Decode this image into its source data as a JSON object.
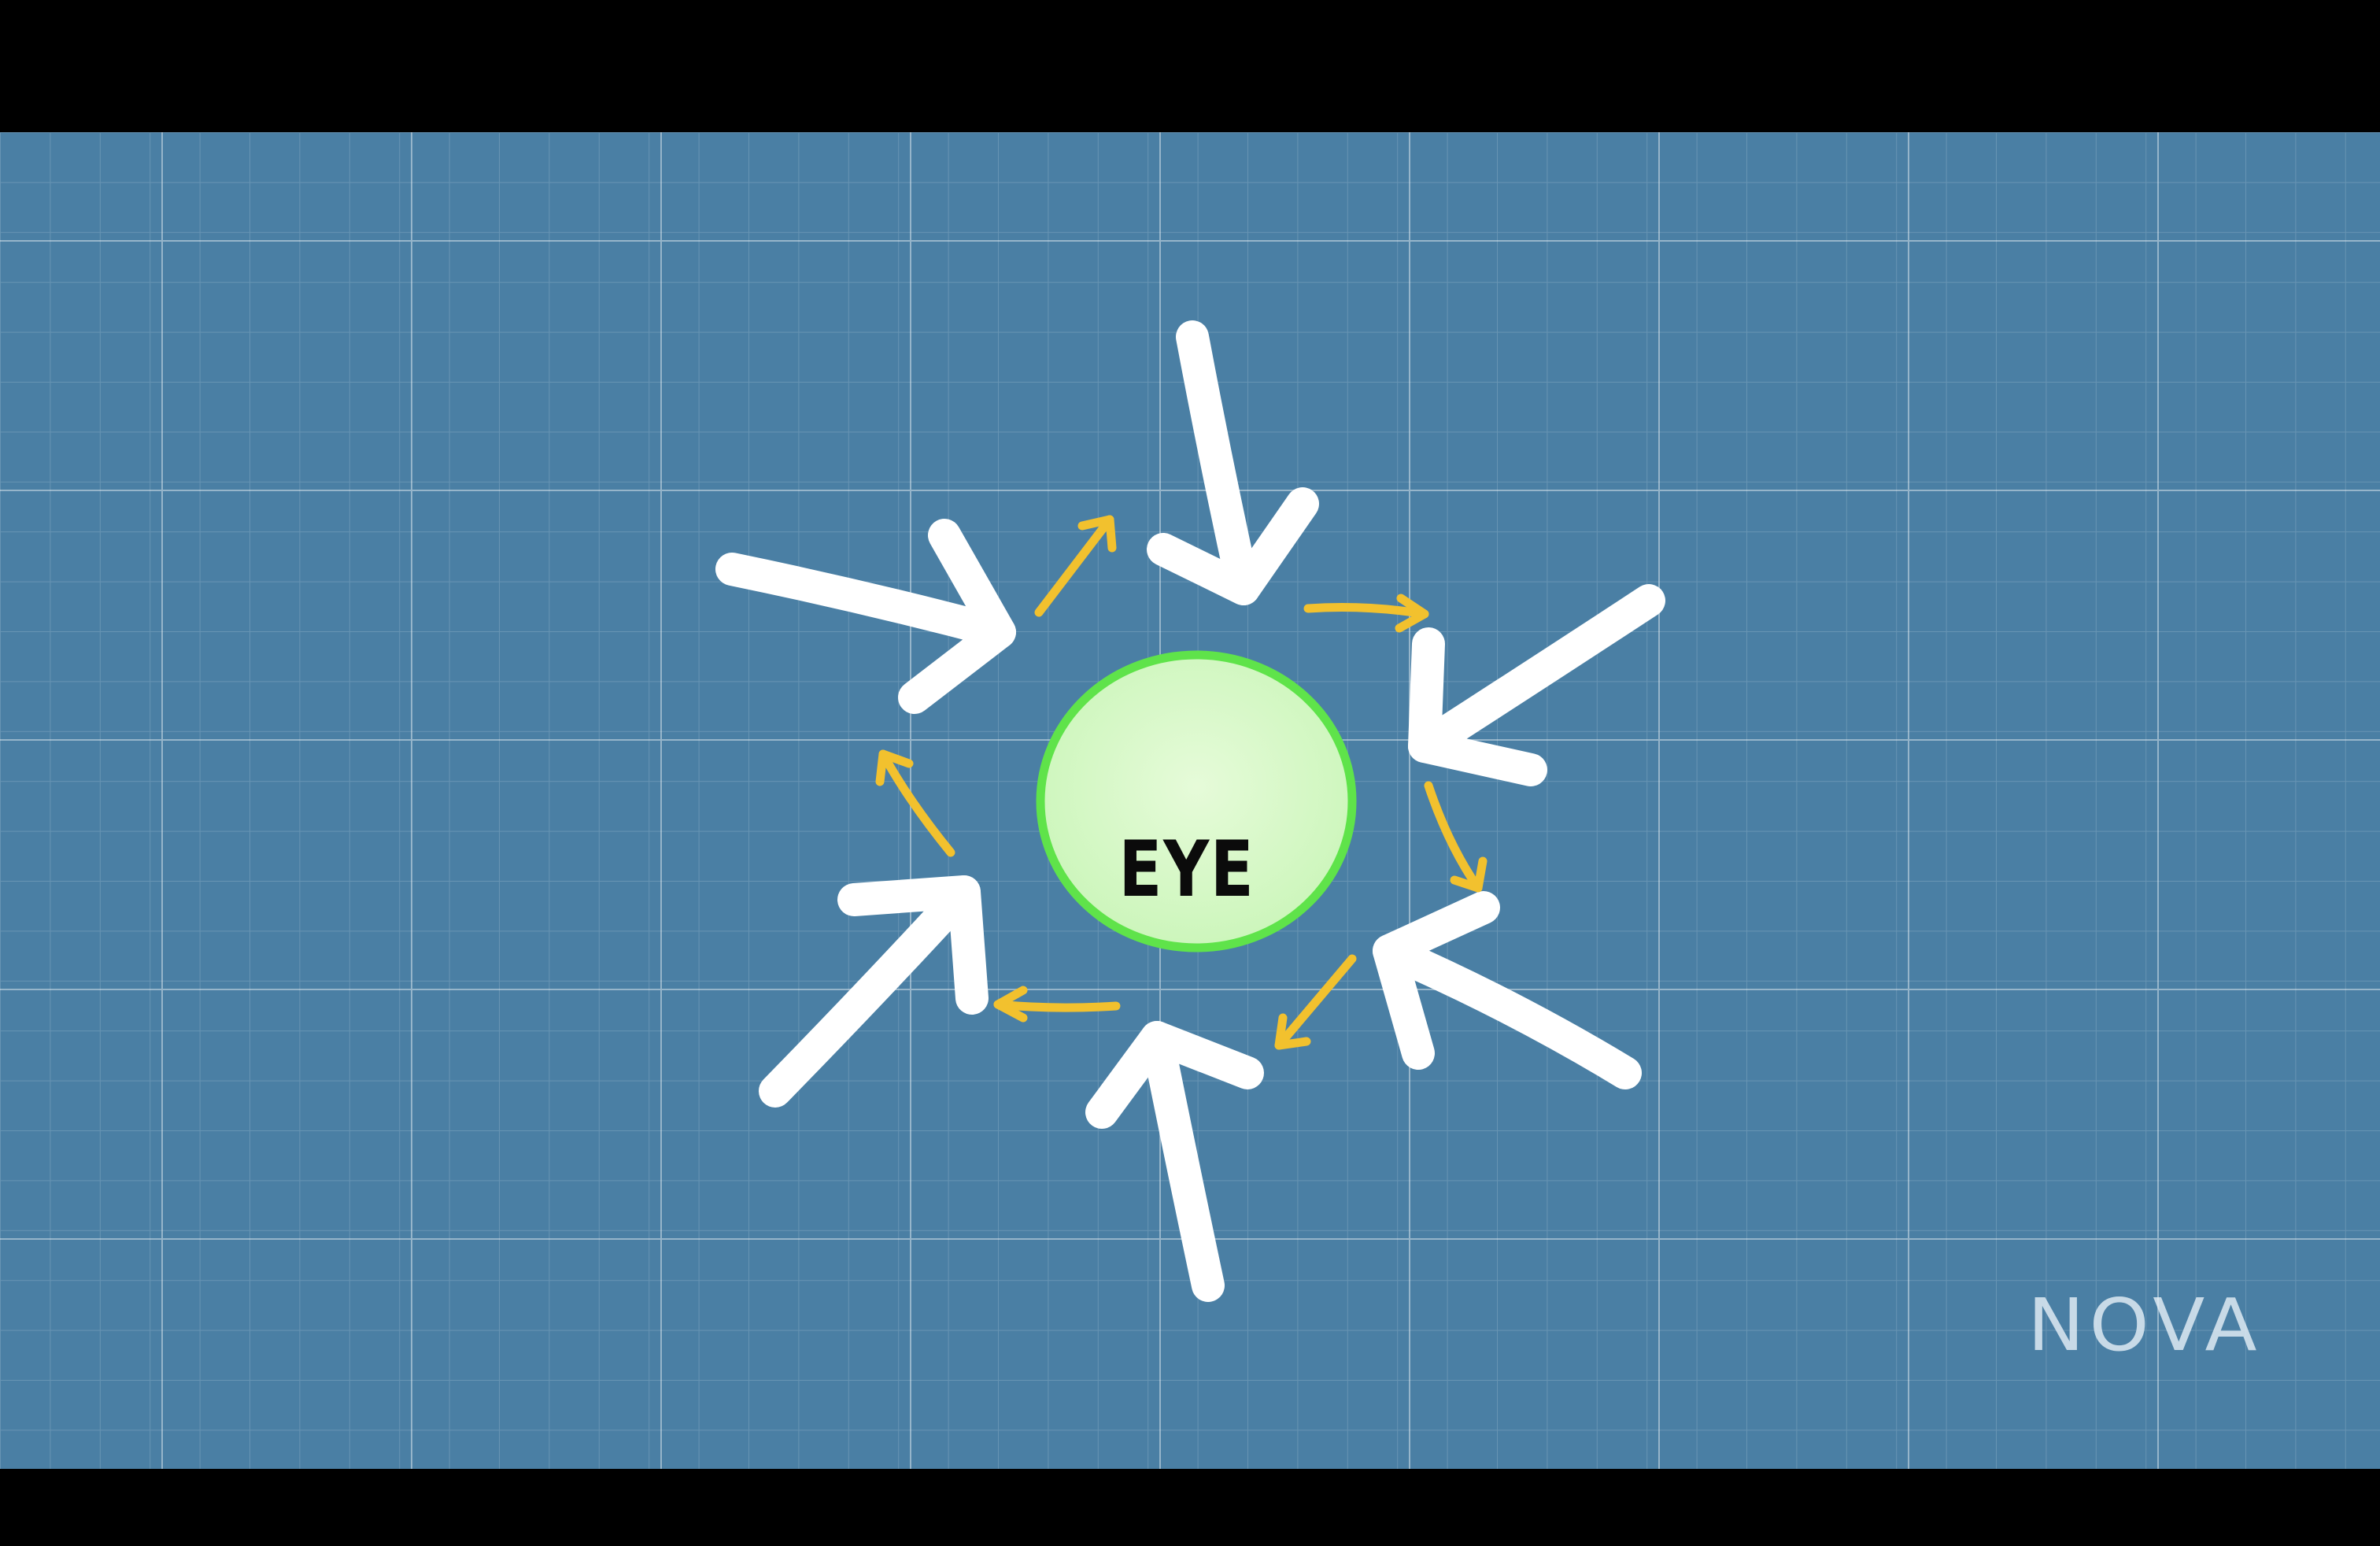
{
  "diagram": {
    "center_label": "EYE"
  },
  "branding": {
    "logo_text": "NOVA"
  }
}
